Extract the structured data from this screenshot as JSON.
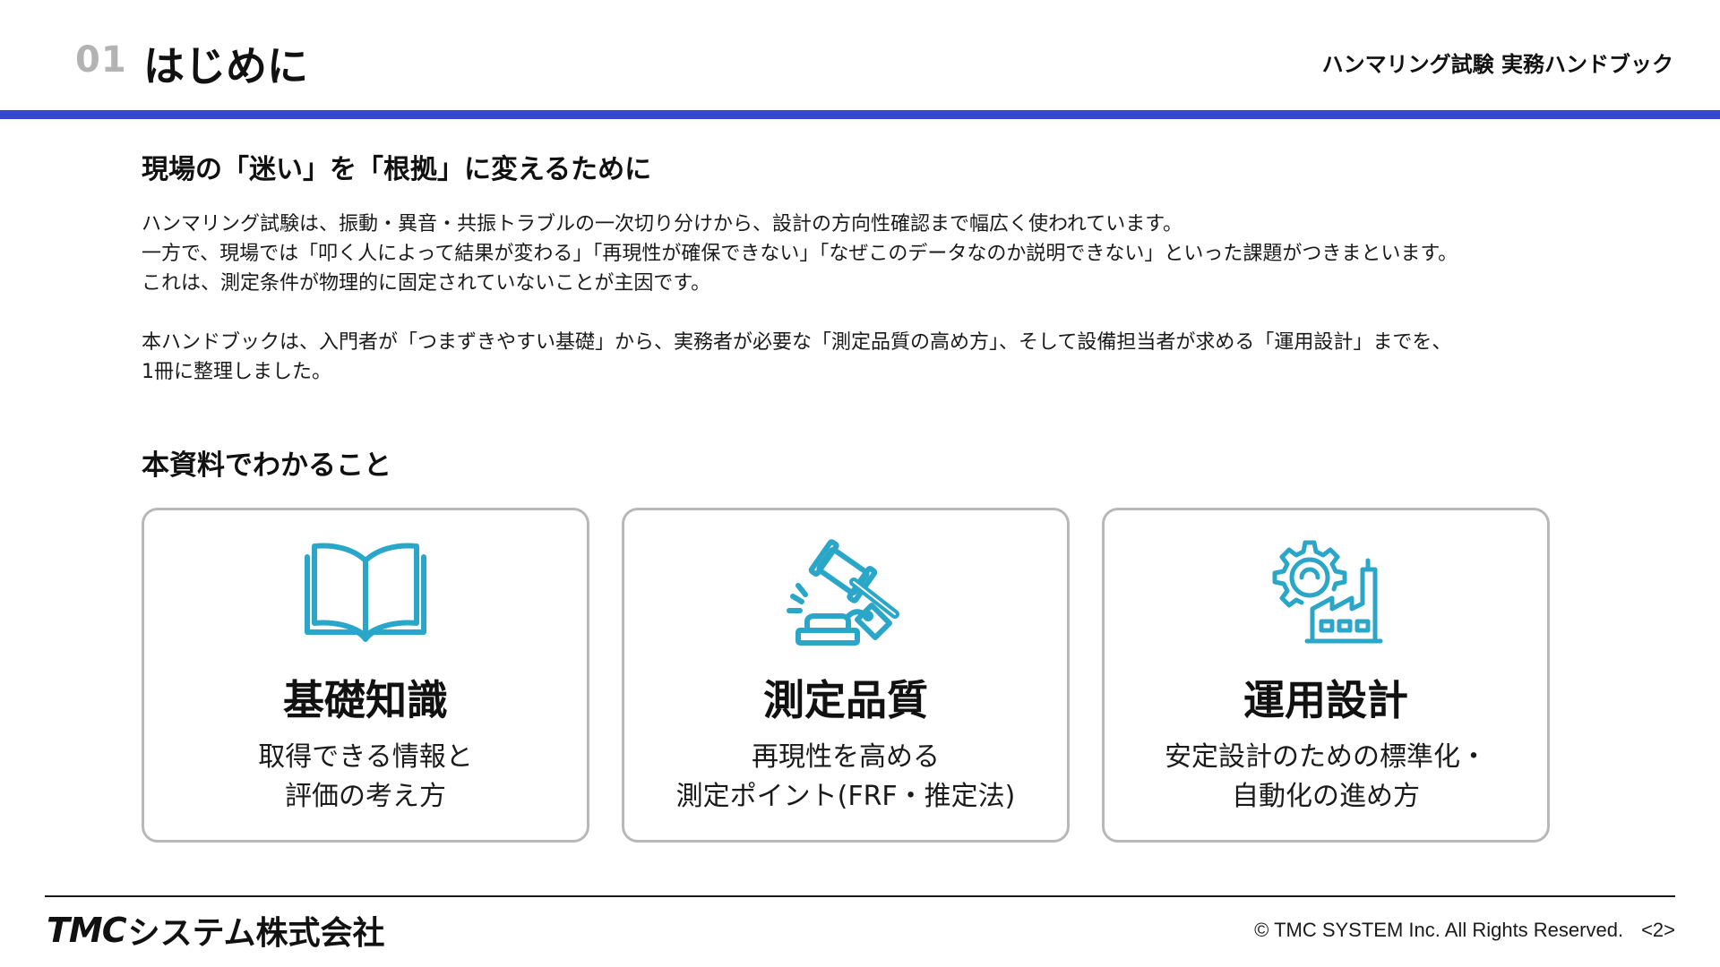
{
  "header": {
    "section_number": "01",
    "section_title": "はじめに",
    "document_title": "ハンマリング試験 実務ハンドブック",
    "accent_color": "#3347cf"
  },
  "intro": {
    "heading": "現場の「迷い」を「根拠」に変えるために",
    "paragraph1": [
      "ハンマリング試験は、振動・異音・共振トラブルの一次切り分けから、設計の方向性確認まで幅広く使われています。",
      "一方で、現場では「叩く人によって結果が変わる」「再現性が確保できない」「なぜこのデータなのか説明できない」といった課題がつきまといます。",
      "これは、測定条件が物理的に固定されていないことが主因です。"
    ],
    "paragraph2": [
      "本ハンドブックは、入門者が「つまずきやすい基礎」から、実務者が必要な「測定品質の高め方」、そして設備担当者が求める「運用設計」までを、",
      "1冊に整理しました。"
    ]
  },
  "learn": {
    "heading": "本資料でわかること",
    "icon_color": "#2aa6c8",
    "cards": [
      {
        "icon": "open-book-icon",
        "title": "基礎知識",
        "desc": [
          "取得できる情報と",
          "評価の考え方"
        ]
      },
      {
        "icon": "gavel-icon",
        "title": "測定品質",
        "desc": [
          "再現性を高める",
          "測定ポイント(FRF・推定法)"
        ]
      },
      {
        "icon": "factory-gear-icon",
        "title": "運用設計",
        "desc": [
          "安定設計のための標準化・",
          "自動化の進め方"
        ]
      }
    ]
  },
  "footer": {
    "logo_mark": "TMC",
    "logo_text": "システム株式会社",
    "copyright": "© TMC SYSTEM Inc. All Rights Reserved.",
    "page_label": "<2>"
  }
}
